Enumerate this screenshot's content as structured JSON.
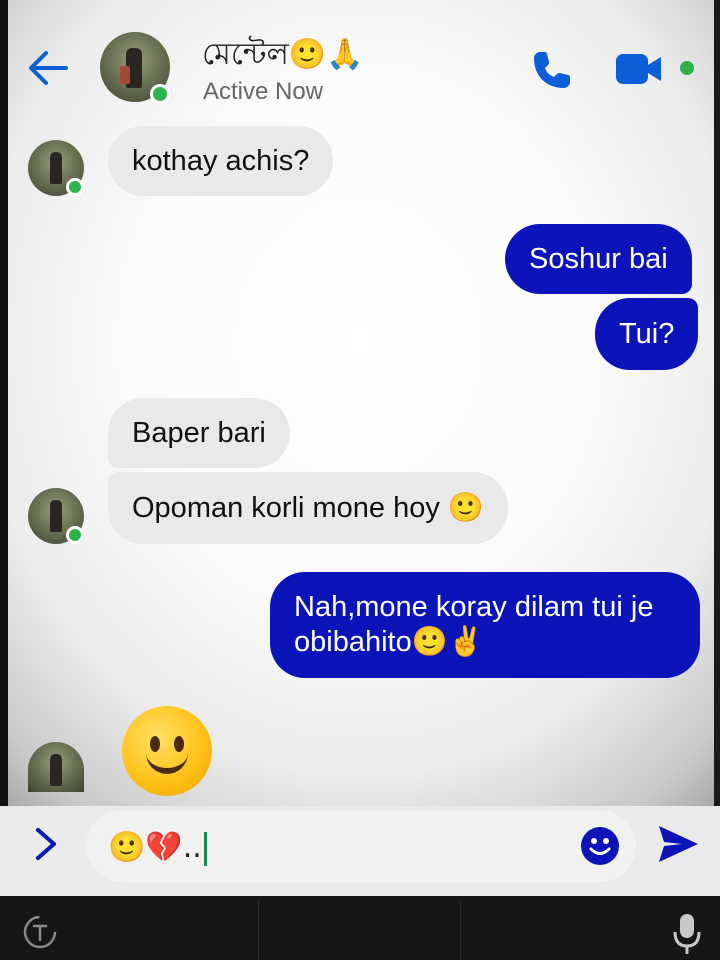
{
  "header": {
    "contact_name": "মেন্টেল🙂🙏",
    "status": "Active Now"
  },
  "messages": [
    {
      "side": "in",
      "text": "kothay achis?"
    },
    {
      "side": "out",
      "text": "Soshur bai"
    },
    {
      "side": "out",
      "text": "Tui?"
    },
    {
      "side": "in",
      "text": "Baper bari"
    },
    {
      "side": "in",
      "text": "Opoman korli mone hoy 🙂"
    },
    {
      "side": "out",
      "text_line1": "Nah,mone koray dilam tui je",
      "text_line2": "obibahito🙂✌"
    },
    {
      "side": "in",
      "text": "🙂"
    }
  ],
  "composer": {
    "input_value": "🙂💔.."
  },
  "colors": {
    "outgoing_bubble": "#0b14b8",
    "incoming_bubble": "#e9e9eb",
    "accent": "#0b5ed7",
    "online": "#2db34a"
  },
  "icons": [
    "back-arrow-icon",
    "phone-icon",
    "video-camera-icon",
    "chevron-right-icon",
    "emoji-icon",
    "send-icon",
    "translate-icon",
    "microphone-icon"
  ]
}
